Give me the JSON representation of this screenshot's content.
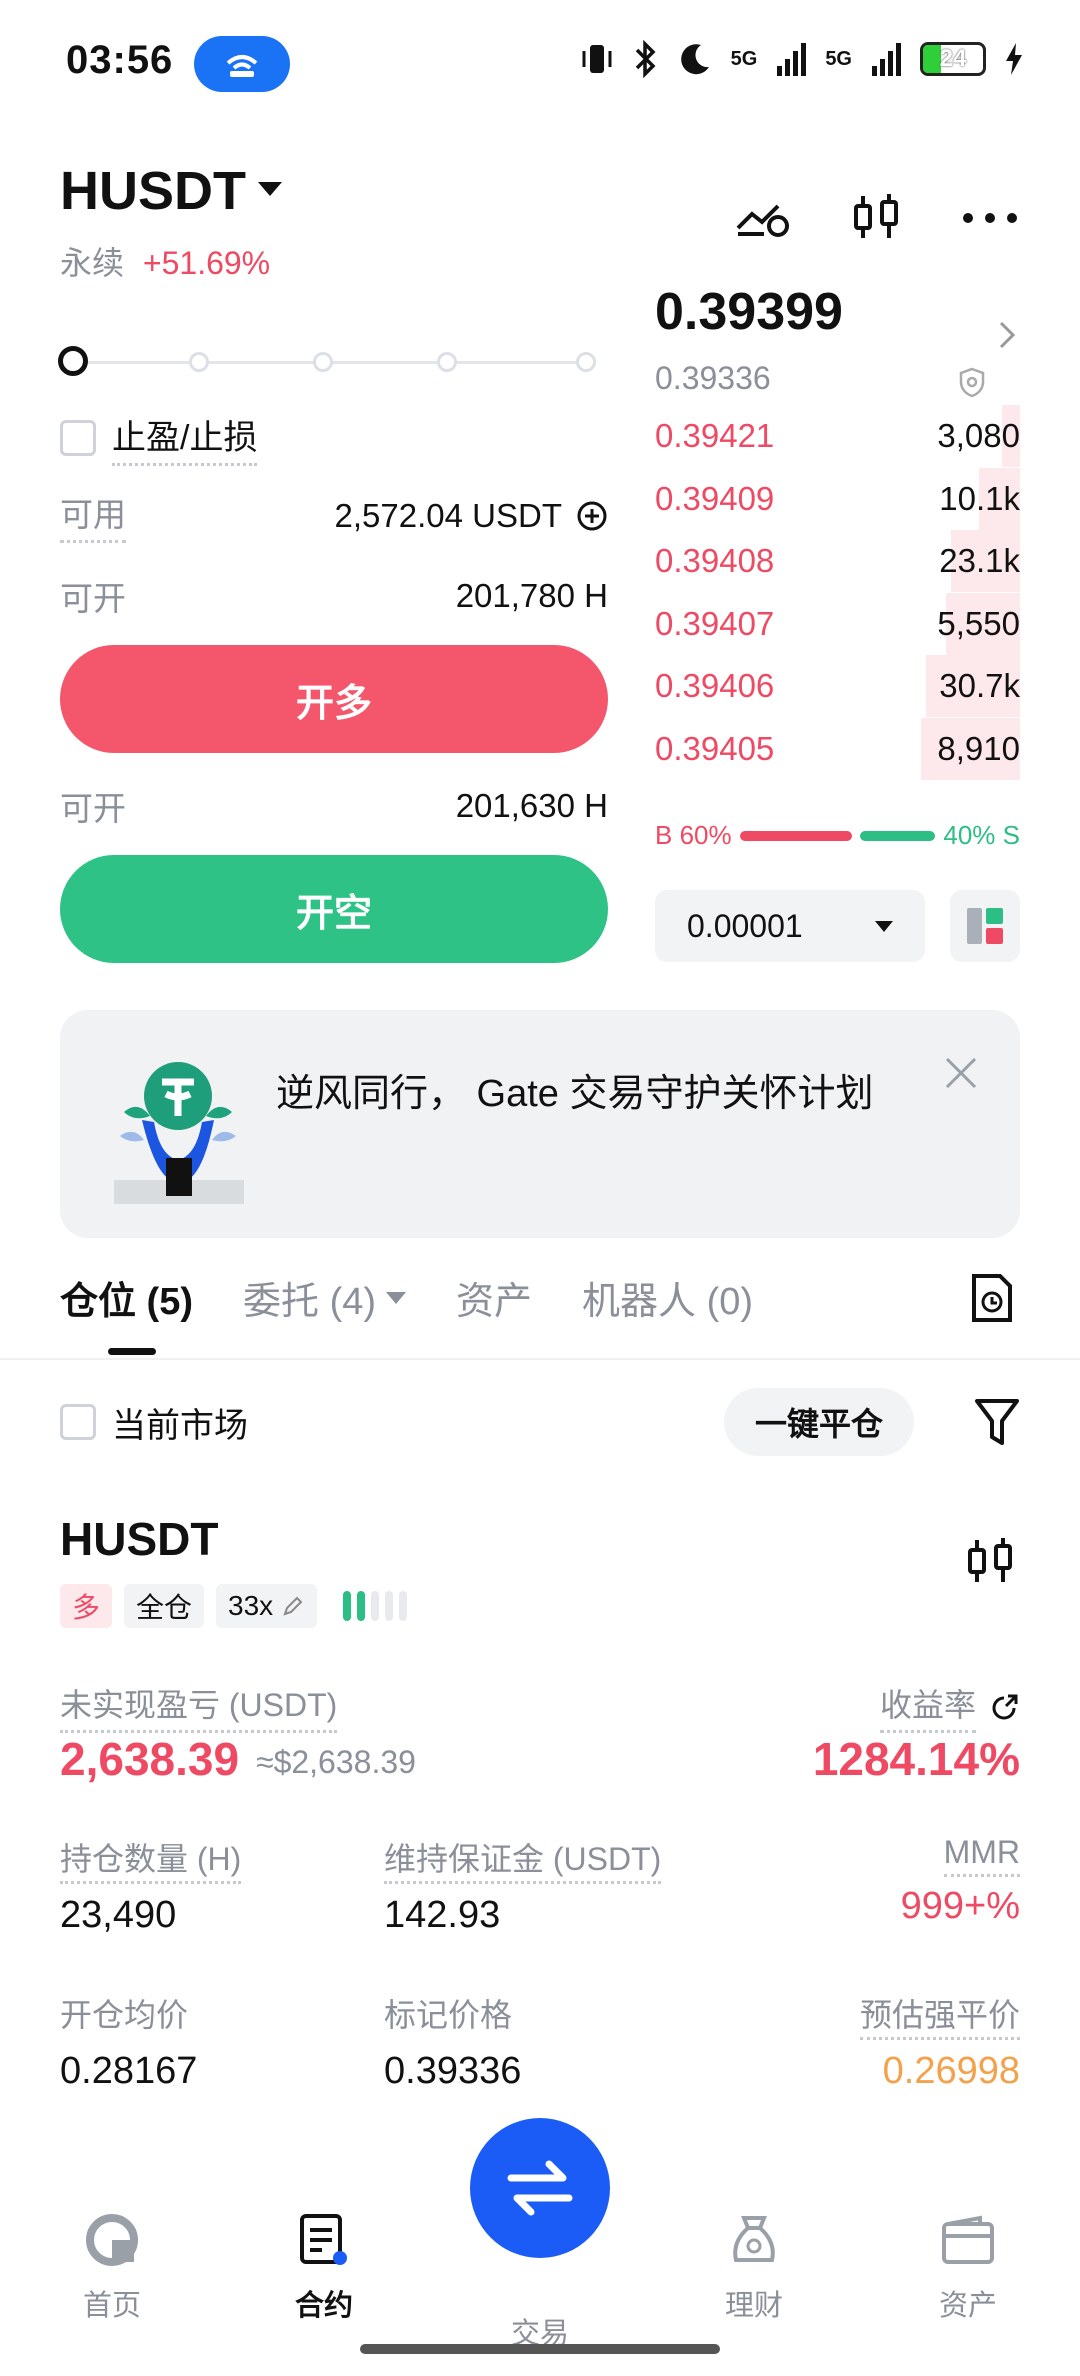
{
  "status": {
    "time": "03:56",
    "network_1": "5G",
    "network_2": "5G",
    "battery": "24"
  },
  "header": {
    "pair": "HUSDT",
    "contract_type": "永续",
    "change": "+51.69%"
  },
  "order_form": {
    "tp_sl_label": "止盈/止损",
    "available_label": "可用",
    "available_value": "2,572.04 USDT",
    "open_long_label": "可开",
    "open_long_value": "201,780 H",
    "long_button": "开多",
    "open_short_label": "可开",
    "open_short_value": "201,630 H",
    "short_button": "开空"
  },
  "order_book": {
    "last_price": "0.39399",
    "mark_price": "0.39336",
    "asks": [
      {
        "price": "0.39421",
        "size": "3,080",
        "depth": 0.08
      },
      {
        "price": "0.39409",
        "size": "10.1k",
        "depth": 0.18
      },
      {
        "price": "0.39408",
        "size": "23.1k",
        "depth": 0.3
      },
      {
        "price": "0.39407",
        "size": "5,550",
        "depth": 0.32
      },
      {
        "price": "0.39406",
        "size": "30.7k",
        "depth": 0.41
      },
      {
        "price": "0.39405",
        "size": "8,910",
        "depth": 0.43
      }
    ],
    "buy_ratio": "B 60%",
    "sell_ratio": "40% S",
    "precision": "0.00001"
  },
  "banner": {
    "text": "逆风同行， Gate 交易守护关怀计划"
  },
  "tabs": {
    "positions": "仓位 (5)",
    "orders": "委托 (4)",
    "assets": "资产",
    "bots": "机器人 (0)"
  },
  "filter": {
    "current_market": "当前市场",
    "close_all": "一键平仓"
  },
  "position": {
    "symbol": "HUSDT",
    "side": "多",
    "margin_mode": "全仓",
    "leverage": "33x",
    "pnl_label": "未实现盈亏 (USDT)",
    "pnl_value": "2,638.39",
    "pnl_approx": "≈$2,638.39",
    "roe_label": "收益率",
    "roe_value": "1284.14%",
    "size_label": "持仓数量 (H)",
    "size_value": "23,490",
    "maint_margin_label": "维持保证金 (USDT)",
    "maint_margin_value": "142.93",
    "mmr_label": "MMR",
    "mmr_value": "999+%",
    "entry_label": "开仓均价",
    "entry_value": "0.28167",
    "mark_label": "标记价格",
    "mark_value": "0.39336",
    "liq_label": "预估强平价",
    "liq_value": "0.26998"
  },
  "nav": {
    "home": "首页",
    "futures": "合约",
    "trade": "交易",
    "earn": "理财",
    "assets": "资产"
  },
  "colors": {
    "red": "#ee4a64",
    "green": "#2dbe85",
    "orange": "#f4a14b",
    "blue": "#1a5cf5"
  }
}
